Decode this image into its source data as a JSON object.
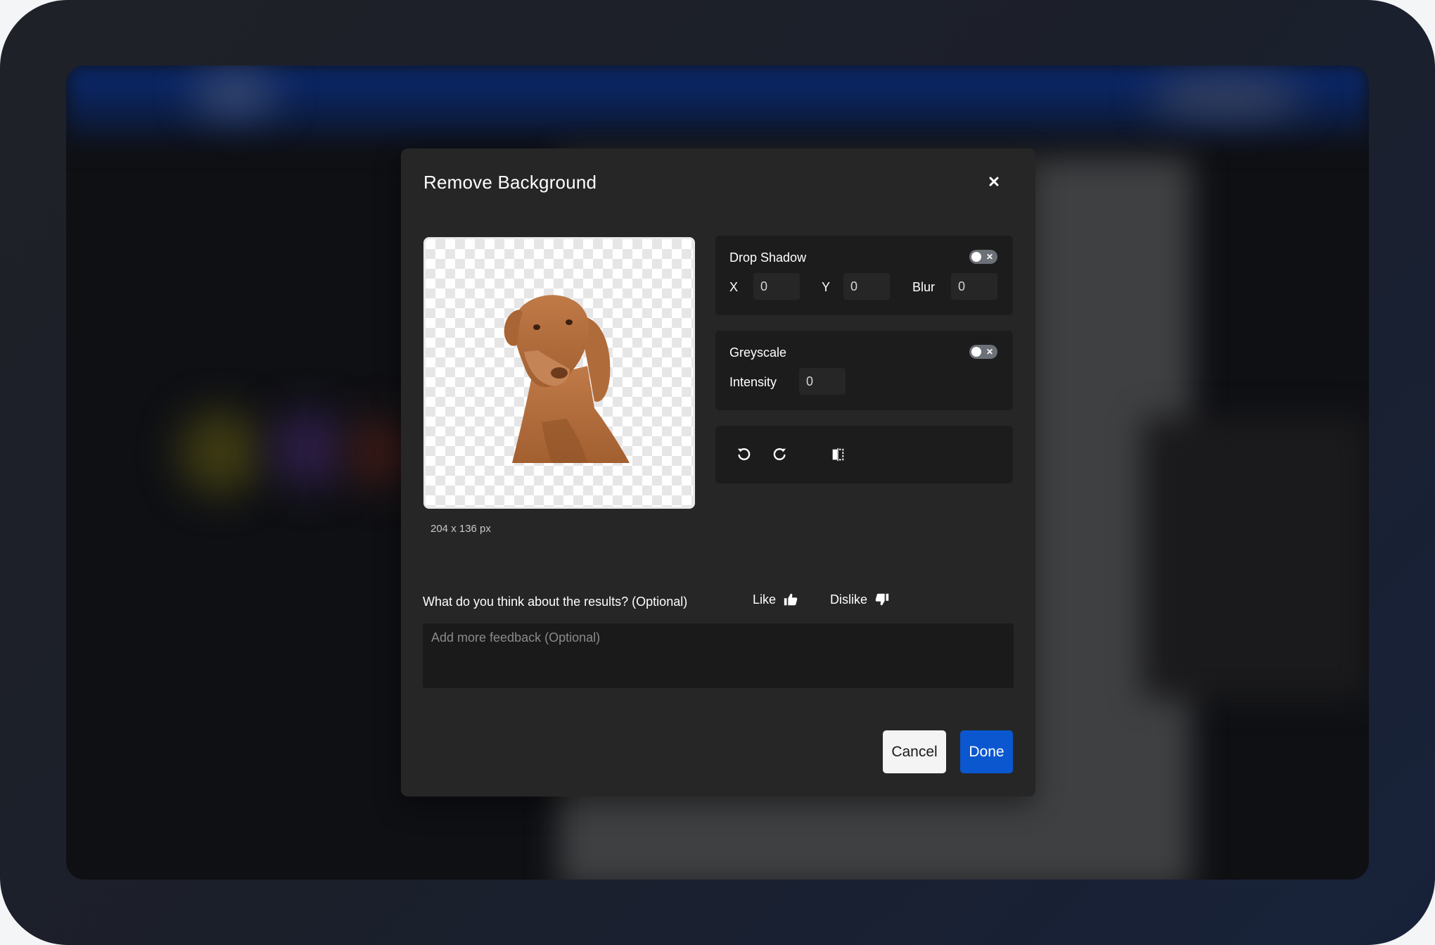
{
  "dialog": {
    "title": "Remove Background",
    "close_icon": "close-icon",
    "image_dimensions": "204 x 136 px"
  },
  "drop_shadow": {
    "label": "Drop Shadow",
    "enabled": false,
    "x_label": "X",
    "x_value": "0",
    "y_label": "Y",
    "y_value": "0",
    "blur_label": "Blur",
    "blur_value": "0"
  },
  "greyscale": {
    "label": "Greyscale",
    "enabled": false,
    "intensity_label": "Intensity",
    "intensity_value": "0"
  },
  "tools": {
    "rotate_left_icon": "rotate-left-icon",
    "rotate_right_icon": "rotate-right-icon",
    "flip_icon": "flip-horizontal-icon"
  },
  "feedback": {
    "question": "What do you think about the results? (Optional)",
    "like_label": "Like",
    "dislike_label": "Dislike",
    "placeholder": "Add more feedback (Optional)"
  },
  "actions": {
    "cancel_label": "Cancel",
    "done_label": "Done"
  },
  "colors": {
    "dialog_bg": "#262626",
    "panel_bg": "#1c1c1c",
    "primary": "#0b57d0",
    "toggle_off": "#6c7077"
  }
}
